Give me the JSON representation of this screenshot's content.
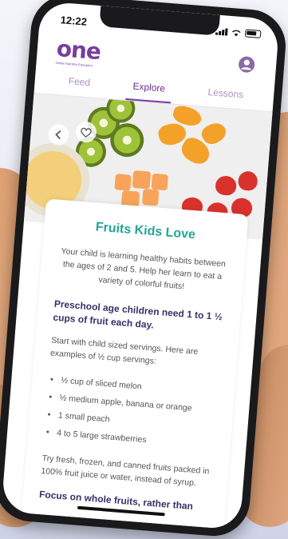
{
  "status": {
    "time": "12:22"
  },
  "header": {
    "logo": "one",
    "logo_tagline": "Online Nutrition Education"
  },
  "tabs": [
    {
      "label": "Feed"
    },
    {
      "label": "Explore"
    },
    {
      "label": "Lessons"
    }
  ],
  "article": {
    "title": "Fruits Kids Love",
    "intro": "Your child is learning healthy habits between the ages of 2 and 5. Help her learn to eat a variety of colorful fruits!",
    "subheading": "Preschool age children need 1 to 1 ½ cups of fruit each day.",
    "body_1": "Start with child sized servings. Here are examples of ½ cup servings:",
    "servings": [
      "½ cup of sliced melon",
      "½ medium apple, banana or orange",
      "1 small peach",
      "4 to 5 large strawberries"
    ],
    "body_2": "Try fresh, frozen, and canned fruits packed in 100% fruit juice or water, instead of syrup.",
    "subheading_2": "Focus on whole fruits, rather than"
  },
  "colors": {
    "brand_purple": "#7a3ca0",
    "teal": "#24a596",
    "navy": "#3b2f6a"
  }
}
